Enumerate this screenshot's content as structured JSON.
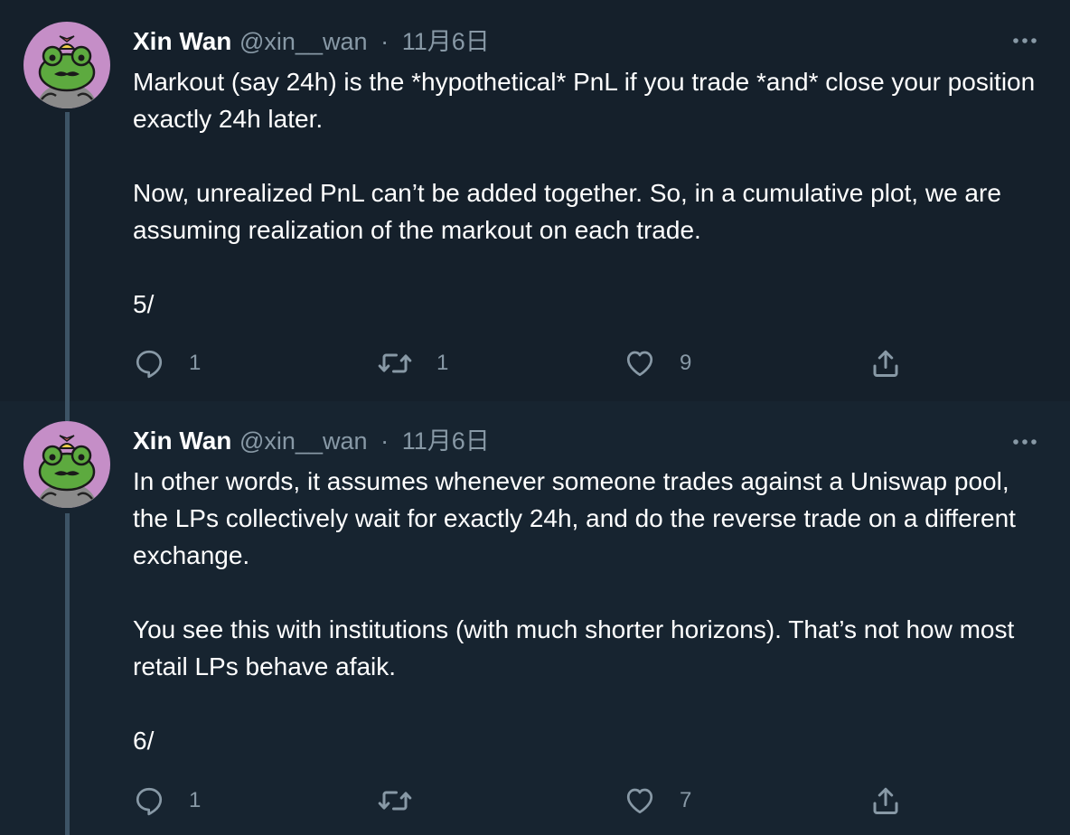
{
  "tweets": [
    {
      "author": {
        "name": "Xin Wan",
        "handle": "@xin__wan",
        "separator": "·",
        "date": "11月6日"
      },
      "paragraphs": [
        "Markout (say 24h) is the *hypothetical* PnL if you trade *and* close your position exactly 24h later.",
        "Now, unrealized PnL can’t be added together. So, in a cumulative plot, we are assuming realization of the markout on each trade.",
        "5/"
      ],
      "actions": {
        "reply_count": "1",
        "retweet_count": "1",
        "like_count": "9",
        "share_count": ""
      }
    },
    {
      "author": {
        "name": "Xin Wan",
        "handle": "@xin__wan",
        "separator": "·",
        "date": "11月6日"
      },
      "paragraphs": [
        "In other words, it assumes whenever someone trades against a Uniswap pool, the LPs collectively wait for exactly 24h, and do the reverse trade on a different exchange.",
        "You see this with institutions (with much shorter horizons). That’s not how most retail LPs behave afaik.",
        "6/"
      ],
      "actions": {
        "reply_count": "1",
        "retweet_count": "",
        "like_count": "7",
        "share_count": ""
      }
    }
  ],
  "icons": {
    "reply": "reply-icon",
    "retweet": "retweet-icon",
    "like": "heart-icon",
    "share": "share-icon",
    "more": "more-options-icon"
  },
  "colors": {
    "background": "#15202b",
    "secondary_text": "#8899a6",
    "thread_line": "#3d5466",
    "avatar_bg": "#c58ec7",
    "frog_green": "#5daa3f"
  }
}
